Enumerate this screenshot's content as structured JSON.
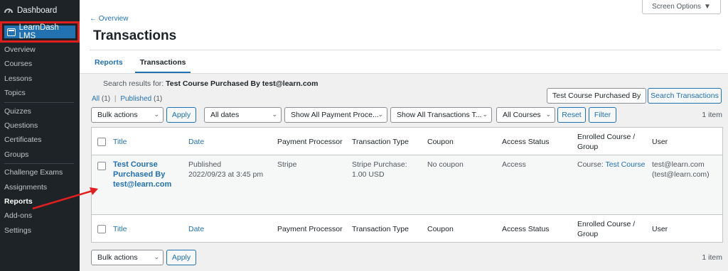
{
  "sidebar": {
    "dashboard": "Dashboard",
    "learndash": "LearnDash LMS",
    "items": [
      {
        "label": "Overview"
      },
      {
        "label": "Courses"
      },
      {
        "label": "Lessons"
      },
      {
        "label": "Topics"
      },
      {
        "label": "Quizzes"
      },
      {
        "label": "Questions"
      },
      {
        "label": "Certificates"
      },
      {
        "label": "Groups"
      },
      {
        "label": "Challenge Exams"
      },
      {
        "label": "Assignments"
      },
      {
        "label": "Reports"
      },
      {
        "label": "Add-ons"
      },
      {
        "label": "Settings"
      }
    ]
  },
  "header": {
    "screen_options": "Screen Options",
    "overview_link": "← Overview",
    "title": "Transactions",
    "tabs": [
      {
        "label": "Reports"
      },
      {
        "label": "Transactions"
      }
    ]
  },
  "search": {
    "results_prefix": "Search results for:",
    "results_query": "Test Course Purchased By test@learn.com",
    "value": "Test Course Purchased By",
    "button": "Search Transactions"
  },
  "views": {
    "all": "All",
    "all_count": "(1)",
    "separator": "|",
    "published": "Published",
    "published_count": "(1)"
  },
  "filters": {
    "bulk_actions": "Bulk actions",
    "apply": "Apply",
    "dates": "All dates",
    "payment": "Show All Payment Proce...",
    "transactions": "Show All Transactions T...",
    "courses": "All Courses",
    "reset": "Reset",
    "filter": "Filter",
    "count": "1 item"
  },
  "table": {
    "columns": [
      "Title",
      "Date",
      "Payment Processor",
      "Transaction Type",
      "Coupon",
      "Access Status",
      "Enrolled Course / Group",
      "User"
    ],
    "row": {
      "title": "Test Course Purchased By test@learn.com",
      "status": "Published",
      "date": "2022/09/23 at 3:45 pm",
      "processor": "Stripe",
      "type_line1": "Stripe Purchase:",
      "type_line2": "1.00 USD",
      "coupon": "No coupon",
      "access": "Access",
      "course_prefix": "Course:",
      "course_link": "Test Course",
      "user_email": "test@learn.com",
      "user_paren": "(test@learn.com)"
    }
  },
  "footer": {
    "bulk_actions": "Bulk actions",
    "apply": "Apply",
    "count": "1 item"
  },
  "colors": {
    "accent": "#2271b1",
    "highlight": "#e02020",
    "sidebar_bg": "#1d2327"
  }
}
